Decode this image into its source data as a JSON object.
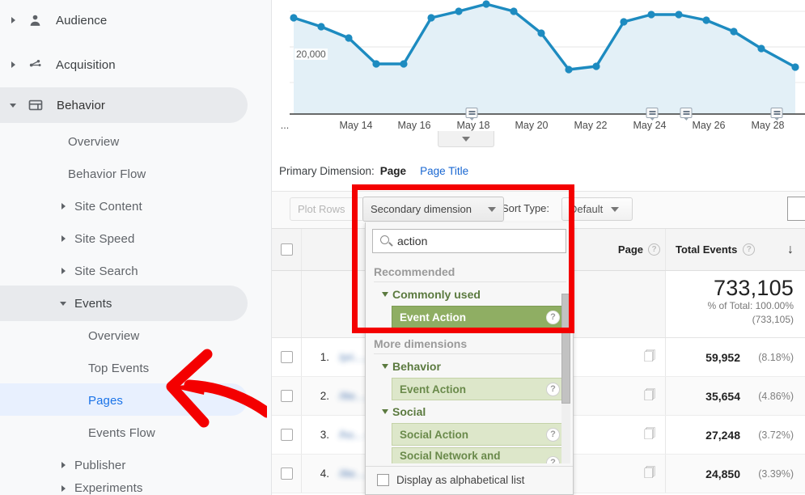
{
  "sidebar": {
    "items": [
      {
        "label": "Audience",
        "level": 1,
        "icon": "person-icon",
        "arrow": "right",
        "state": "normal"
      },
      {
        "label": "Acquisition",
        "level": 1,
        "icon": "network-icon",
        "arrow": "right",
        "state": "normal"
      },
      {
        "label": "Behavior",
        "level": 1,
        "icon": "window-icon",
        "arrow": "down",
        "state": "expanded"
      },
      {
        "label": "Overview",
        "level": 2,
        "icon": "",
        "arrow": "none",
        "state": "normal"
      },
      {
        "label": "Behavior Flow",
        "level": 2,
        "icon": "",
        "arrow": "none",
        "state": "normal"
      },
      {
        "label": "Site Content",
        "level": 2,
        "icon": "",
        "arrow": "right",
        "state": "normal"
      },
      {
        "label": "Site Speed",
        "level": 2,
        "icon": "",
        "arrow": "right",
        "state": "normal"
      },
      {
        "label": "Site Search",
        "level": 2,
        "icon": "",
        "arrow": "right",
        "state": "normal"
      },
      {
        "label": "Events",
        "level": 2,
        "icon": "",
        "arrow": "down",
        "state": "expanded"
      },
      {
        "label": "Overview",
        "level": 3,
        "icon": "",
        "arrow": "none",
        "state": "normal"
      },
      {
        "label": "Top Events",
        "level": 3,
        "icon": "",
        "arrow": "none",
        "state": "normal"
      },
      {
        "label": "Pages",
        "level": 3,
        "icon": "",
        "arrow": "none",
        "state": "selected"
      },
      {
        "label": "Events Flow",
        "level": 3,
        "icon": "",
        "arrow": "none",
        "state": "normal"
      },
      {
        "label": "Publisher",
        "level": 2,
        "icon": "",
        "arrow": "right",
        "state": "normal"
      },
      {
        "label": "Experiments",
        "level": 2,
        "icon": "",
        "arrow": "right",
        "state": "cut-off"
      }
    ]
  },
  "chart_data": {
    "type": "line",
    "title": "",
    "xlabel": "",
    "ylabel": "",
    "grid": true,
    "legend_position": "none",
    "y_tick_labels": [
      "20,000"
    ],
    "y_tick_values": [
      20000
    ],
    "ylim": [
      0,
      40000
    ],
    "x_tick_labels": [
      "...",
      "May 14",
      "May 16",
      "May 18",
      "May 20",
      "May 22",
      "May 24",
      "May 26",
      "May 28"
    ],
    "series": [
      {
        "name": "Total Events",
        "color": "#1d8bc0",
        "fill_color": "#e3f0f7",
        "x": [
          "May 12",
          "May 13",
          "May 14",
          "May 15",
          "May 16",
          "May 17",
          "May 18",
          "May 19",
          "May 20",
          "May 21",
          "May 22",
          "May 23",
          "May 24",
          "May 25",
          "May 26",
          "May 27",
          "May 28",
          "May 29",
          "May 30"
        ],
        "values": [
          31500,
          29500,
          27500,
          20800,
          20800,
          31500,
          33000,
          34500,
          33000,
          27000,
          19800,
          20600,
          30500,
          32400,
          32400,
          31000,
          28000,
          23500,
          16000
        ]
      }
    ],
    "annotation_markers": [
      "May 18",
      "May 24",
      "May 25",
      "May 28"
    ]
  },
  "primary_dimension": {
    "label": "Primary Dimension:",
    "active": "Page",
    "link": "Page Title"
  },
  "toolbar": {
    "plot_rows_label": "Plot Rows",
    "secondary_dimension_label": "Secondary dimension",
    "sort_type_label": "Sort Type:",
    "sort_type_value": "Default"
  },
  "secondary_dimension_panel": {
    "search_value": "action",
    "search_icon": "search-icon",
    "sections": [
      {
        "heading": "Recommended",
        "groups": [
          {
            "name": "Commonly used",
            "items": [
              {
                "label": "Event Action",
                "highlighted": true
              }
            ]
          }
        ]
      },
      {
        "heading": "More dimensions",
        "groups": [
          {
            "name": "Behavior",
            "items": [
              {
                "label": "Event Action",
                "highlighted": false
              }
            ]
          },
          {
            "name": "Social",
            "items": [
              {
                "label": "Social Action",
                "highlighted": false
              },
              {
                "label": "Social Network and Action (Hit)",
                "highlighted": false
              }
            ]
          }
        ]
      }
    ],
    "footer_checkbox_label": "Display as alphabetical list",
    "footer_checkbox_checked": false
  },
  "table": {
    "columns": {
      "page": "Page",
      "total_events": "Total Events"
    },
    "sort_indicator": "↓",
    "summary": {
      "value": "733,105",
      "percent_line": "% of Total: 100.00%",
      "total_line": "(733,105)"
    },
    "rows": [
      {
        "rank": "1.",
        "page": "/pri......",
        "total_events": "59,952",
        "percent": "(8.18%)"
      },
      {
        "rank": "2.",
        "page": "/ilte......",
        "total_events": "35,654",
        "percent": "(4.86%)"
      },
      {
        "rank": "3.",
        "page": "/ho... -p...",
        "total_events": "27,248",
        "percent": "(3.72%)"
      },
      {
        "rank": "4.",
        "page": "/ilte......",
        "total_events": "24,850",
        "percent": "(3.39%)"
      }
    ]
  },
  "annotations": {
    "box_color": "#f40000",
    "arrow_color": "#f40000",
    "box_target": "secondary-dimension-dropdown",
    "arrow_target": "sidebar-item-pages"
  }
}
